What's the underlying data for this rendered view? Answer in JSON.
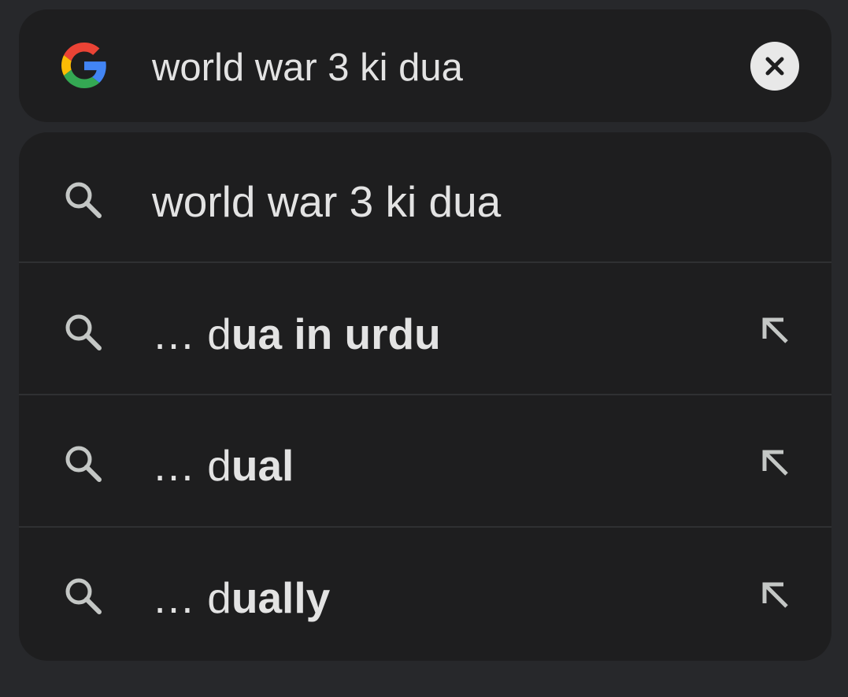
{
  "search": {
    "query": "world war 3 ki dua",
    "logo_icon": "google-g-icon",
    "clear_icon": "close-icon"
  },
  "suggestions": [
    {
      "prefix": "world war 3 ki dua",
      "typed": "",
      "completion": "",
      "icon": "search-icon",
      "has_arrow": false
    },
    {
      "prefix": "… ",
      "typed": "d",
      "completion": "ua in urdu",
      "icon": "search-icon",
      "has_arrow": true
    },
    {
      "prefix": "… ",
      "typed": "d",
      "completion": "ual",
      "icon": "search-icon",
      "has_arrow": true
    },
    {
      "prefix": "… ",
      "typed": "d",
      "completion": "ually",
      "icon": "search-icon",
      "has_arrow": true
    }
  ],
  "colors": {
    "background": "#27282b",
    "surface": "#1e1e1f",
    "text": "#e3e3e3",
    "icon": "#c4c7c5",
    "google_blue": "#4285F4",
    "google_red": "#EA4335",
    "google_yellow": "#FBBC05",
    "google_green": "#34A853"
  }
}
